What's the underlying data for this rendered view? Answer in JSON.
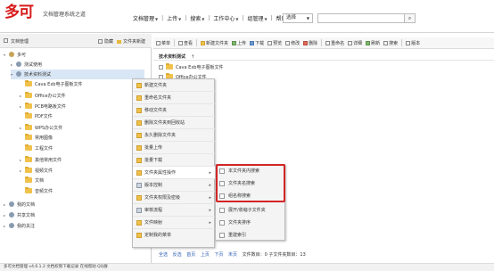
{
  "header": {
    "logo": "多可",
    "slogan": "文档管理系统之道",
    "nav": [
      {
        "label": "文档管理",
        "active": true,
        "has_menu": true
      },
      {
        "label": "上传",
        "has_menu": true
      },
      {
        "label": "搜索",
        "has_menu": true
      },
      {
        "label": "工作中心",
        "has_menu": true
      },
      {
        "label": "组管理",
        "has_menu": true
      },
      {
        "label": "帮助",
        "has_menu": false
      }
    ],
    "select_label": "选择",
    "search_value": ""
  },
  "left_panel": {
    "title": "文档管理",
    "hide_label": "隐藏",
    "new_folder_label": "文件夹新建",
    "tree": [
      {
        "label": "多可",
        "type": "root",
        "level": 0
      },
      {
        "label": "测试使用",
        "type": "user",
        "level": 1
      },
      {
        "label": "技术资料测试",
        "type": "user",
        "level": 1,
        "selected": true
      },
      {
        "label": "Cava Exb电子图板文件",
        "type": "folder",
        "level": 2
      },
      {
        "label": "Office办公文件",
        "type": "folder",
        "level": 2
      },
      {
        "label": "PCB电路板文件",
        "type": "folder",
        "level": 2
      },
      {
        "label": "PDF文件",
        "type": "folder",
        "level": 2
      },
      {
        "label": "WPS办公文件",
        "type": "folder",
        "level": 2
      },
      {
        "label": "常用图像",
        "type": "folder",
        "level": 2
      },
      {
        "label": "工程文件",
        "type": "folder",
        "level": 2
      },
      {
        "label": "其他常用文件",
        "type": "folder",
        "level": 2
      },
      {
        "label": "视频文件",
        "type": "folder",
        "level": 2
      },
      {
        "label": "文档",
        "type": "folder",
        "level": 2
      },
      {
        "label": "音频文件",
        "type": "folder",
        "level": 2
      },
      {
        "label": "我的文档",
        "type": "folder",
        "level": 0
      },
      {
        "label": "共享文档",
        "type": "folder",
        "level": 0
      },
      {
        "label": "我的关注",
        "type": "folder",
        "level": 0
      }
    ]
  },
  "toolbar": {
    "items": [
      {
        "label": "菜单",
        "icon": "menu-icon"
      },
      {
        "label": "查看",
        "icon": "view-icon"
      },
      {
        "label": "新建文件夹",
        "icon": "new-folder-icon"
      },
      {
        "label": "上传",
        "icon": "upload-icon"
      },
      {
        "label": "下载",
        "icon": "download-icon"
      },
      {
        "label": "预览",
        "icon": "preview-icon"
      },
      {
        "label": "修改",
        "icon": "edit-icon"
      },
      {
        "label": "删除",
        "icon": "delete-icon"
      },
      {
        "label": "重命名",
        "icon": "rename-icon"
      },
      {
        "label": "详细",
        "icon": "detail-icon"
      },
      {
        "label": "刷新",
        "icon": "refresh-icon"
      },
      {
        "label": "搜索",
        "icon": "search-icon"
      },
      {
        "label": "版本",
        "icon": "version-icon"
      }
    ]
  },
  "main": {
    "breadcrumb": "技术资料测试",
    "breadcrumb_arrow": "↑",
    "rows": [
      {
        "label": "Cava Exb电子图板文件"
      },
      {
        "label": "Office办公文件"
      }
    ],
    "pager": {
      "links": [
        "全选",
        "反选",
        "首页",
        "上页",
        "下页",
        "末页"
      ],
      "summary": "文件数目：0   子文件夹数目：13"
    }
  },
  "context_menu": {
    "items": [
      {
        "label": "新建文件夹",
        "submenu": false
      },
      {
        "label": "重命名文件夹",
        "submenu": false
      },
      {
        "label": "移动文件夹",
        "submenu": false
      },
      {
        "label": "删除文件夹到回收站",
        "submenu": false
      },
      {
        "label": "永久删除文件夹",
        "submenu": false
      },
      {
        "label": "批量上传",
        "submenu": false
      },
      {
        "label": "批量下载",
        "submenu": false
      },
      {
        "label": "文件夹属性操作",
        "submenu": true,
        "highlighted": true
      },
      {
        "label": "版本控制",
        "submenu": true
      },
      {
        "label": "文件夹权限及密级",
        "submenu": true
      },
      {
        "label": "审核流程",
        "submenu": true
      },
      {
        "label": "文件映射",
        "submenu": true
      },
      {
        "label": "定制我的菜单",
        "submenu": false
      }
    ]
  },
  "submenu": {
    "items": [
      {
        "label": "本文件夹内搜索",
        "boxed": true
      },
      {
        "label": "文件夹名搜索",
        "boxed": true
      },
      {
        "label": "组名称搜索",
        "boxed": true
      },
      {
        "label": "展开/收缩子文件夹"
      },
      {
        "label": "文件夹排序"
      },
      {
        "label": "重建索引"
      }
    ],
    "highlight_color": "#d32424"
  },
  "statusbar": {
    "text": "多可文档管理 v4.6.1.2    文档权限下载记录  在线帮助   QQ群"
  }
}
